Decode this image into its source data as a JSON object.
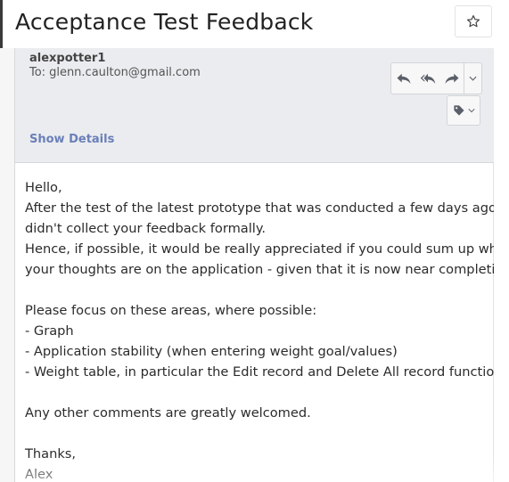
{
  "subject": "Acceptance Test Feedback",
  "header": {
    "sender": "alexpotter1",
    "to_label": "To:",
    "to_address": "glenn.caulton@gmail.com",
    "show_details": "Show Details",
    "icons": [
      "star-icon",
      "reply-icon",
      "reply-all-icon",
      "forward-icon",
      "chevron-down-icon",
      "tag-icon"
    ]
  },
  "body": {
    "lines": [
      "Hello,",
      "After the test of the latest prototype that was conducted a few days ago, I",
      "didn't collect your feedback formally.",
      "Hence, if possible, it would be really appreciated if you could sum up what",
      "your thoughts are on the application - given that it is now near completion.",
      "",
      "Please focus on these areas, where possible:",
      "- Graph",
      "- Application stability (when entering weight goal/values)",
      "- Weight table, in particular the Edit record and Delete All record functions",
      "",
      "Any other comments are greatly welcomed.",
      "",
      "Thanks,",
      "Alex"
    ]
  },
  "colors": {
    "header_bg": "#eaecef",
    "link": "#6b7fb8",
    "text": "#2b2b2b"
  }
}
